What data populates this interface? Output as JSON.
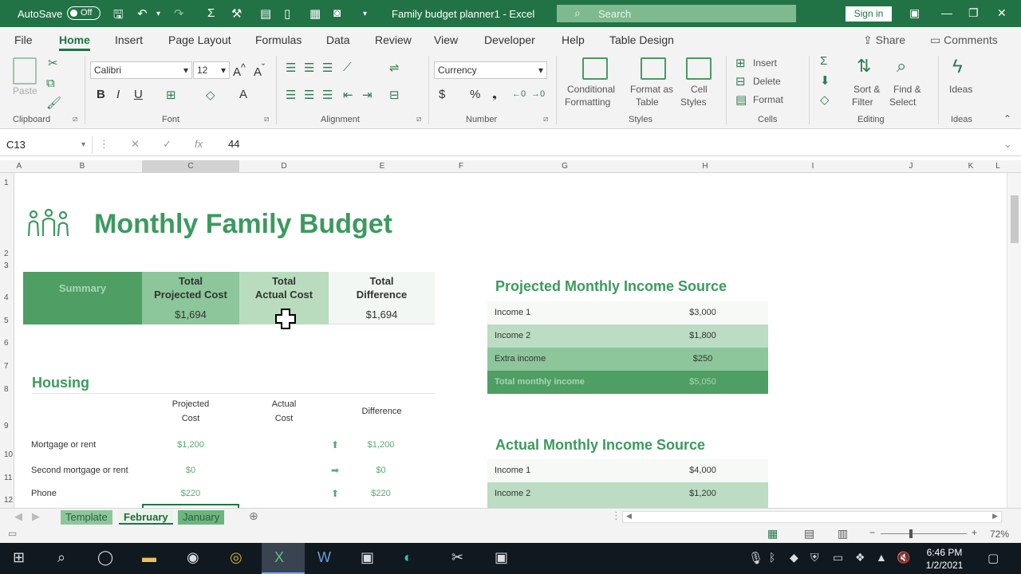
{
  "titlebar": {
    "autosave_label": "AutoSave",
    "autosave_state": "Off",
    "doc_title": "Family budget planner1  -  Excel",
    "search_placeholder": "Search",
    "signin_label": "Sign in"
  },
  "tabs": [
    "File",
    "Home",
    "Insert",
    "Page Layout",
    "Formulas",
    "Data",
    "Review",
    "View",
    "Developer",
    "Help",
    "Table Design"
  ],
  "share_label": "Share",
  "comments_label": "Comments",
  "ribbon": {
    "clipboard": {
      "paste": "Paste",
      "label": "Clipboard"
    },
    "font": {
      "name": "Calibri",
      "size": "12",
      "label": "Font"
    },
    "alignment": {
      "label": "Alignment"
    },
    "number": {
      "format": "Currency",
      "label": "Number"
    },
    "styles": {
      "conditional": [
        "Conditional",
        "Formatting"
      ],
      "format_table": [
        "Format as",
        "Table"
      ],
      "cell_styles": [
        "Cell",
        "Styles"
      ],
      "label": "Styles"
    },
    "cells": {
      "insert": "Insert",
      "delete": "Delete",
      "format": "Format",
      "label": "Cells"
    },
    "editing": {
      "sort": [
        "Sort &",
        "Filter"
      ],
      "find": [
        "Find &",
        "Select"
      ],
      "label": "Editing"
    },
    "ideas": {
      "btn": "Ideas",
      "label": "Ideas"
    }
  },
  "formula_bar": {
    "cell_ref": "C13",
    "value": "44"
  },
  "columns": [
    "A",
    "B",
    "C",
    "D",
    "E",
    "F",
    "G",
    "H",
    "I",
    "J",
    "K",
    "L"
  ],
  "rows": [
    "1",
    "2",
    "3",
    "4",
    "5",
    "6",
    "7",
    "8",
    "9",
    "10",
    "11",
    "12"
  ],
  "sheet": {
    "title": "Monthly Family Budget",
    "summary": {
      "label": "Summary",
      "projected_label_1": "Total",
      "projected_label_2": "Projected Cost",
      "projected_value": "$1,694",
      "actual_label_1": "Total",
      "actual_label_2": "Actual Cost",
      "difference_label_1": "Total",
      "difference_label_2": "Difference",
      "difference_value": "$1,694"
    },
    "housing": {
      "title": "Housing",
      "col_projected": [
        "Projected",
        "Cost"
      ],
      "col_actual": [
        "Actual",
        "Cost"
      ],
      "col_difference": "Difference",
      "rows": [
        {
          "name": "Mortgage or rent",
          "projected": "$1,200",
          "difference": "$1,200"
        },
        {
          "name": "Second mortgage or rent",
          "projected": "$0",
          "difference": "$0"
        },
        {
          "name": "Phone",
          "projected": "$220",
          "difference": "$220"
        }
      ]
    },
    "projected_income": {
      "title": "Projected Monthly Income Source",
      "rows": [
        {
          "name": "Income 1",
          "value": "$3,000"
        },
        {
          "name": "Income 2",
          "value": "$1,800"
        },
        {
          "name": "Extra income",
          "value": "$250"
        },
        {
          "name": "Total monthly income",
          "value": "$5,050"
        }
      ]
    },
    "actual_income": {
      "title": "Actual Monthly Income Source",
      "rows": [
        {
          "name": "Income 1",
          "value": "$4,000"
        },
        {
          "name": "Income 2",
          "value": "$1,200"
        }
      ]
    }
  },
  "sheet_tabs": [
    "Template",
    "February",
    "January"
  ],
  "status": {
    "zoom": "72%"
  },
  "taskbar": {
    "time": "6:46 PM",
    "date": "1/2/2021"
  }
}
